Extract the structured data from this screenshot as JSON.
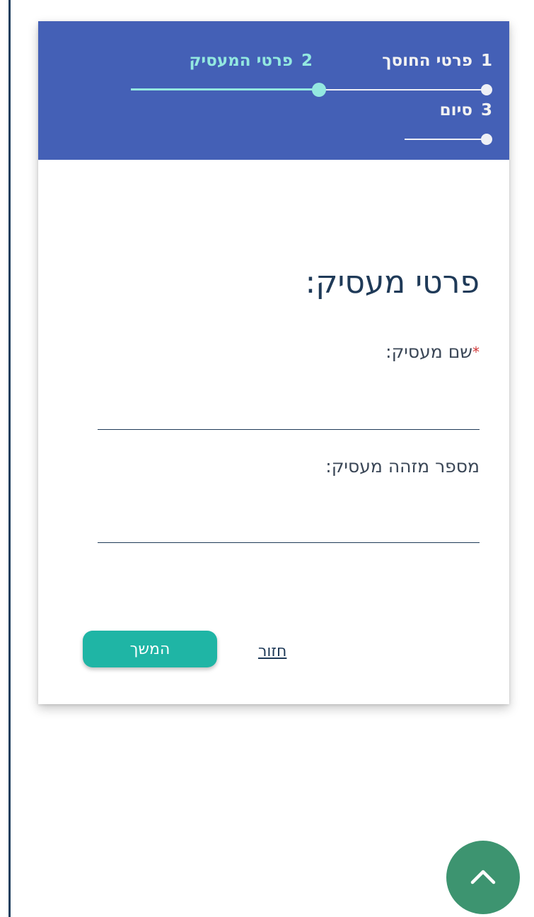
{
  "stepper": {
    "steps": [
      {
        "number": "1",
        "label": "פרטי החוסך",
        "state": "done"
      },
      {
        "number": "2",
        "label": "פרטי המעסיק",
        "state": "active"
      },
      {
        "number": "3",
        "label": "סיום",
        "state": "pending"
      }
    ],
    "colors": {
      "background": "#4460b6",
      "active": "#93e8e0",
      "inactive": "#eef0f6"
    }
  },
  "form": {
    "title": "פרטי מעסיק:",
    "fields": [
      {
        "label": "שם מעסיק:",
        "required": true,
        "value": "",
        "placeholder": ""
      },
      {
        "label": "מספר מזהה מעסיק:",
        "required": false,
        "value": "",
        "placeholder": ""
      }
    ]
  },
  "actions": {
    "continue_label": "המשך",
    "back_label": "חזור"
  },
  "scroll_top": {
    "icon": "chevron-up-icon",
    "color": "#3d9470"
  }
}
